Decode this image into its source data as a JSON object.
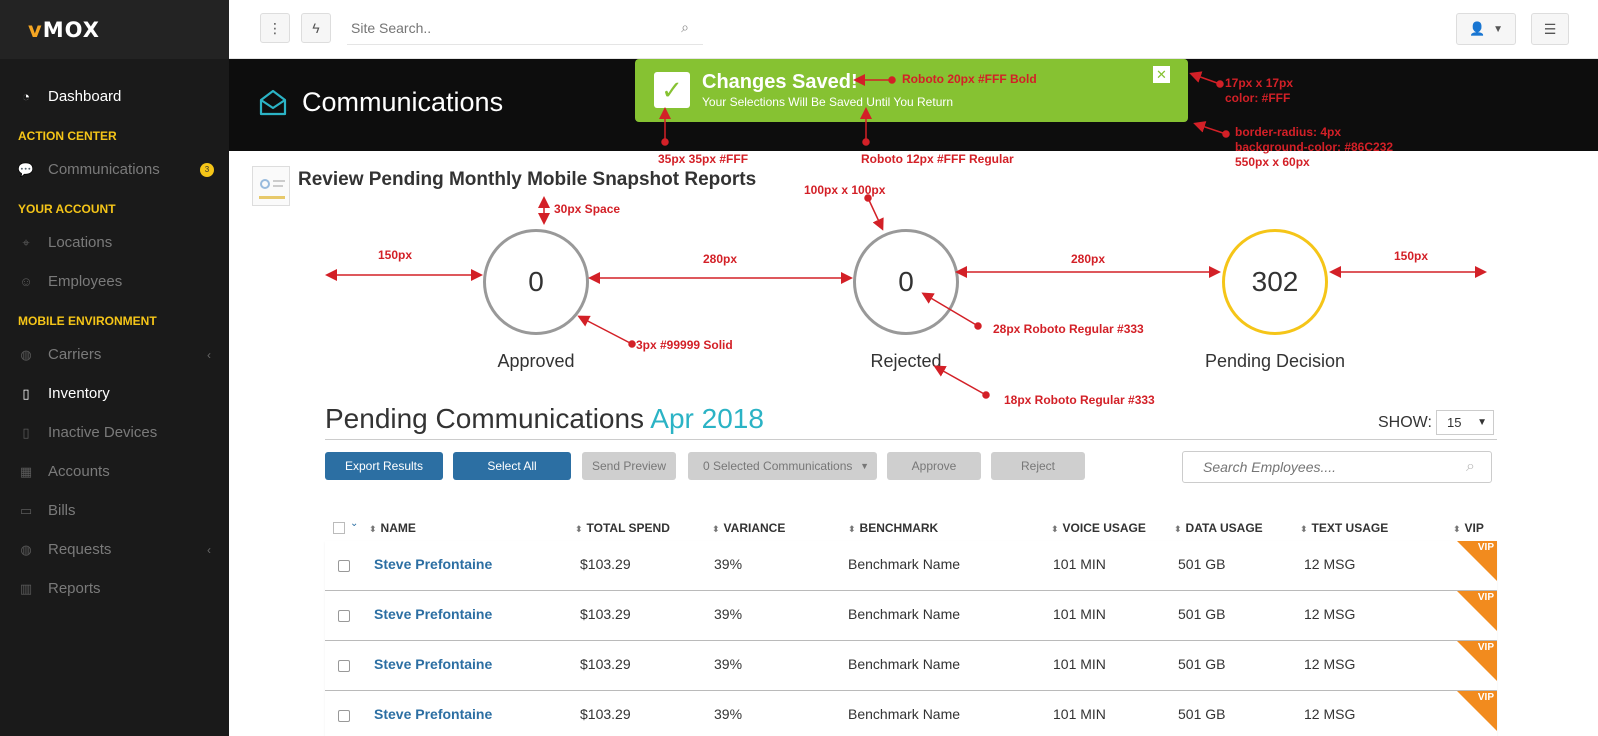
{
  "app": {
    "logo_accent": "v",
    "logo_text": "MOX"
  },
  "sidebar": {
    "dashboard": "Dashboard",
    "action_center": "ACTION CENTER",
    "communications": "Communications",
    "comm_badge": "3",
    "your_account": "YOUR ACCOUNT",
    "locations": "Locations",
    "employees": "Employees",
    "mobile_env": "MOBILE ENVIRONMENT",
    "carriers": "Carriers",
    "inventory": "Inventory",
    "inactive_devices": "Inactive Devices",
    "accounts": "Accounts",
    "bills": "Bills",
    "requests": "Requests",
    "reports": "Reports"
  },
  "topbar": {
    "search_placeholder": "Site Search.."
  },
  "header": {
    "title": "Communications"
  },
  "toast": {
    "title": "Changes Saved!",
    "message": "Your Selections Will Be Saved Until You Return",
    "close": "✕",
    "color": "#86C232"
  },
  "annotations": {
    "a1": "Roboto 20px #FFF Bold",
    "a2": "17px x 17px",
    "a3": "color: #FFF",
    "a4": "border-radius: 4px",
    "a5": "background-color: #86C232",
    "a6": "550px x 60px",
    "a7": "35px 35px #FFF",
    "a8": "Roboto 12px #FFF Regular",
    "a9": "100px x 100px",
    "a10": "30px Space",
    "a11": "150px",
    "a12": "280px",
    "a13": "280px",
    "a14": "150px",
    "a15": "3px #99999 Solid",
    "a16": "28px Roboto Regular #333",
    "a17": "18px Roboto Regular #333"
  },
  "report": {
    "title": "Review Pending Monthly Mobile Snapshot Reports"
  },
  "stats": [
    {
      "value": "0",
      "label": "Approved"
    },
    {
      "value": "0",
      "label": "Rejected"
    },
    {
      "value": "302",
      "label": "Pending Decision"
    }
  ],
  "pending": {
    "title": "Pending Communications",
    "date": "Apr 2018",
    "show_label": "SHOW:",
    "show_value": "15"
  },
  "buttons": {
    "export": "Export Results",
    "select_all": "Select All",
    "send_preview": "Send Preview",
    "selected": "0 Selected Communications",
    "approve": "Approve",
    "reject": "Reject",
    "search_placeholder": "Search Employees...."
  },
  "table": {
    "headers": [
      "NAME",
      "TOTAL SPEND",
      "VARIANCE",
      "BENCHMARK",
      "VOICE USAGE",
      "DATA USAGE",
      "TEXT USAGE",
      "VIP"
    ],
    "rows": [
      {
        "name": "Steve Prefontaine",
        "spend": "$103.29",
        "variance": "39%",
        "benchmark": "Benchmark Name",
        "voice": "101 MIN",
        "data": "501 GB",
        "text": "12 MSG",
        "vip": "VIP"
      },
      {
        "name": "Steve Prefontaine",
        "spend": "$103.29",
        "variance": "39%",
        "benchmark": "Benchmark Name",
        "voice": "101 MIN",
        "data": "501 GB",
        "text": "12 MSG",
        "vip": "VIP"
      },
      {
        "name": "Steve Prefontaine",
        "spend": "$103.29",
        "variance": "39%",
        "benchmark": "Benchmark Name",
        "voice": "101 MIN",
        "data": "501 GB",
        "text": "12 MSG",
        "vip": "VIP"
      },
      {
        "name": "Steve Prefontaine",
        "spend": "$103.29",
        "variance": "39%",
        "benchmark": "Benchmark Name",
        "voice": "101 MIN",
        "data": "501 GB",
        "text": "12 MSG",
        "vip": "VIP"
      }
    ]
  }
}
